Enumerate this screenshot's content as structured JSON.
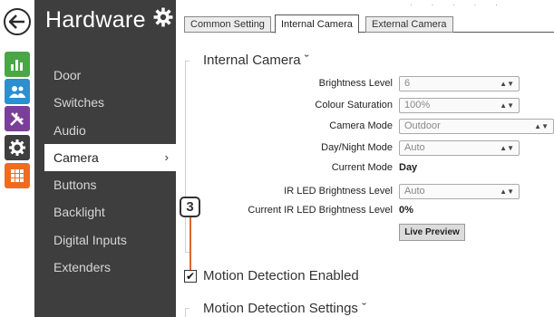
{
  "rail": {
    "back_icon": "back-arrow-icon",
    "items": [
      {
        "icon": "bar-chart-icon",
        "color": "#4aa646"
      },
      {
        "icon": "users-icon",
        "color": "#2c8fcf"
      },
      {
        "icon": "tools-icon",
        "color": "#7a3f98"
      },
      {
        "icon": "gear-icon",
        "color": "#3e3e3e"
      },
      {
        "icon": "grid-icon",
        "color": "#ef6c1f"
      }
    ]
  },
  "sidebar": {
    "title": "Hardware",
    "title_icon": "gear-icon",
    "items": [
      {
        "label": "Door"
      },
      {
        "label": "Switches"
      },
      {
        "label": "Audio"
      },
      {
        "label": "Camera",
        "active": true,
        "chevron": "›"
      },
      {
        "label": "Buttons"
      },
      {
        "label": "Backlight"
      },
      {
        "label": "Digital Inputs"
      },
      {
        "label": "Extenders"
      }
    ]
  },
  "tabs": [
    {
      "label": "Common Setting"
    },
    {
      "label": "Internal Camera",
      "active": true
    },
    {
      "label": "External Camera"
    }
  ],
  "top_dots": "· · · · ·",
  "section": {
    "title": "Internal Camera ˇ",
    "fields": {
      "brightness_level": {
        "label": "Brightness Level",
        "value": "6"
      },
      "colour_saturation": {
        "label": "Colour Saturation",
        "value": "100%"
      },
      "camera_mode": {
        "label": "Camera Mode",
        "value": "Outdoor"
      },
      "day_night_mode": {
        "label": "Day/Night Mode",
        "value": "Auto"
      },
      "current_mode": {
        "label": "Current Mode",
        "value": "Day"
      },
      "ir_led_brightness": {
        "label": "IR LED Brightness Level",
        "value": "Auto"
      },
      "current_ir_led": {
        "label": "Current IR LED Brightness Level",
        "value": "0%"
      }
    },
    "live_preview_button": "Live Preview"
  },
  "callout": {
    "number": "3",
    "line_color": "#e0642d"
  },
  "motion": {
    "checkbox_label": "Motion Detection Enabled",
    "checked": true,
    "settings_title": "Motion Detection Settings ˇ"
  }
}
